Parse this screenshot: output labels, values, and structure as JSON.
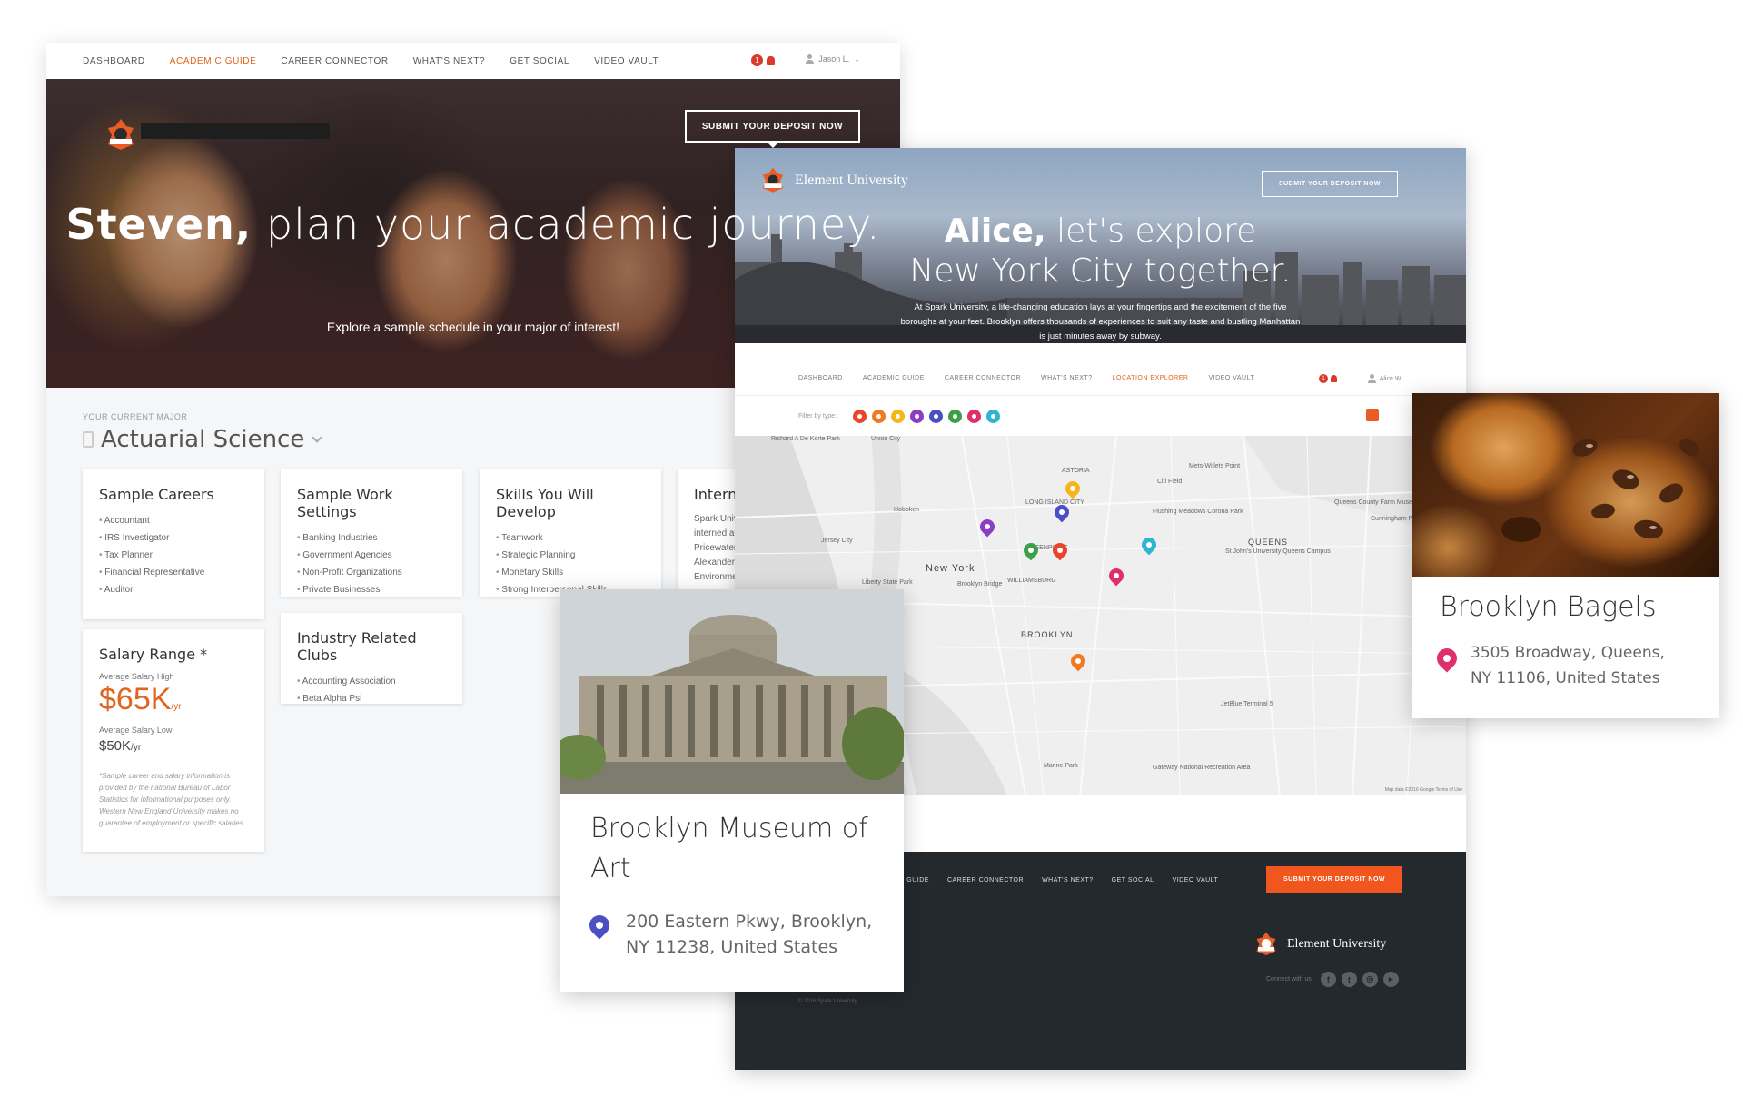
{
  "academic_guide": {
    "nav": {
      "items": [
        "DASHBOARD",
        "ACADEMIC GUIDE",
        "CAREER CONNECTOR",
        "WHAT'S NEXT?",
        "GET SOCIAL",
        "VIDEO VAULT"
      ],
      "active_index": 1,
      "notification_count": "1",
      "user_name": "Jason L."
    },
    "hero": {
      "cta": "SUBMIT YOUR DEPOSIT NOW",
      "headline_bold": "Steven,",
      "headline_rest": " plan your academic journey.",
      "subhead": "Explore a sample schedule in your major of interest!"
    },
    "major": {
      "label": "YOUR CURRENT MAJOR",
      "value": "Actuarial Science"
    },
    "cards": {
      "careers": {
        "title": "Sample Careers",
        "items": [
          "Accountant",
          "IRS Investigator",
          "Tax Planner",
          "Financial Representative",
          "Auditor"
        ]
      },
      "work_settings": {
        "title": "Sample Work Settings",
        "items": [
          "Banking Industries",
          "Government Agencies",
          "Non-Profit Organizations",
          "Private Businesses"
        ]
      },
      "skills": {
        "title": "Skills You Will Develop",
        "items": [
          "Teamwork",
          "Strategic Planning",
          "Monetary Skills",
          "Strong Interpersonal Skills"
        ]
      },
      "internships": {
        "title": "Internsh",
        "lines": [
          "Spark Unive",
          "interned at",
          "Pricewaterh",
          "Alexander A",
          "Environmen"
        ]
      },
      "clubs": {
        "title": "Industry Related Clubs",
        "items": [
          "Accounting Association",
          "Beta Alpha Psi"
        ]
      },
      "salary": {
        "title": "Salary Range *",
        "high_label": "Average Salary High",
        "high_value": "$65K",
        "low_label": "Average Salary Low",
        "low_value": "$50K",
        "unit": "/yr",
        "note": "*Sample career and salary information is provided by the national Bureau of Labor Statistics for informational purposes only. Western New England University makes no guarantee of employment or specific salaries."
      }
    }
  },
  "location_explorer": {
    "brand": "Element University",
    "hero": {
      "cta": "SUBMIT YOUR DEPOSIT NOW",
      "headline_bold": "Alice,",
      "headline_rest_1": " let's explore",
      "headline_rest_2": "New York City together.",
      "sub": "At Spark University, a life-changing education lays at your fingertips and the excitement of the five boroughs at your feet. Brooklyn offers thousands of experiences to suit any taste and bustling Manhattan is just minutes away by subway."
    },
    "nav": {
      "items": [
        "DASHBOARD",
        "ACADEMIC GUIDE",
        "CAREER CONNECTOR",
        "WHAT'S NEXT?",
        "LOCATION EXPLORER",
        "VIDEO VAULT"
      ],
      "active_index": 4,
      "notification_count": "1",
      "user_name": "Alice W."
    },
    "filter": {
      "label": "Filter by type:",
      "colors": [
        "#e8452c",
        "#f07a22",
        "#f5b51d",
        "#8a3ec4",
        "#4a4fc2",
        "#3aa04a",
        "#e0306a",
        "#2fb4d2"
      ]
    },
    "map": {
      "labels": [
        "Union City",
        "Hoboken",
        "Jersey City",
        "New York",
        "Brooklyn Bridge",
        "BROOKLYN",
        "QUEENS",
        "St John's University Queens Campus",
        "Flushing Meadows Corona Park",
        "Citi Field",
        "Queens County Farm Museum",
        "Cunningham Park",
        "JetBlue Terminal 5",
        "Marine Park",
        "Gateway National Recreation Area",
        "Liberty State Park",
        "WILLIAMSBURG",
        "GREENPOINT",
        "LONG ISLAND CITY",
        "ASTORIA",
        "Mets-Willets Point",
        "Richard A De Korte Park"
      ],
      "pin_colors": [
        "#f5b51d",
        "#4a4fc2",
        "#8a3ec4",
        "#3aa04a",
        "#e8452c",
        "#e0306a",
        "#2fb4d2",
        "#f07a22"
      ],
      "credit": "Map data ©2016 Google   Terms of Use"
    },
    "footer": {
      "nav": [
        "...EMIC GUIDE",
        "CAREER CONNECTOR",
        "WHAT'S NEXT?",
        "GET SOCIAL",
        "VIDEO VAULT"
      ],
      "cta": "SUBMIT YOUR DEPOSIT NOW",
      "brand": "Element University",
      "connect_label": "Connect with us",
      "social_icons": [
        "facebook-icon",
        "twitter-icon",
        "instagram-icon",
        "youtube-icon"
      ],
      "copyright": "© 2016 Spark University"
    }
  },
  "place_cards": {
    "museum": {
      "title_line1": "Brooklyn Museum of",
      "title_line2": "Art",
      "address_line1": "200 Eastern Pkwy, Brooklyn,",
      "address_line2": "NY 11238, United States",
      "pin_color": "#4a4fc2"
    },
    "bagels": {
      "title": "Brooklyn Bagels",
      "address_line1": "3505 Broadway, Queens,",
      "address_line2": "NY 11106, United States",
      "pin_color": "#e0306a"
    }
  }
}
